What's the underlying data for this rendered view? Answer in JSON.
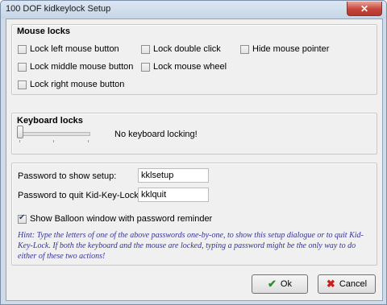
{
  "window": {
    "title": "100 DOF kidkeylock Setup",
    "close_glyph": "✕"
  },
  "mouse_locks": {
    "title": "Mouse locks",
    "options": [
      {
        "label": "Lock left mouse button",
        "checked": false
      },
      {
        "label": "Lock middle mouse button",
        "checked": false
      },
      {
        "label": "Lock right mouse button",
        "checked": false
      },
      {
        "label": "Lock double click",
        "checked": false
      },
      {
        "label": "Lock mouse wheel",
        "checked": false
      },
      {
        "label": "Hide mouse pointer",
        "checked": false
      }
    ]
  },
  "keyboard_locks": {
    "title": "Keyboard locks",
    "slider_value": 0,
    "status": "No keyboard locking!"
  },
  "passwords": {
    "setup_label": "Password to show setup:",
    "setup_value": "kklsetup",
    "quit_label": "Password to quit Kid-Key-Lock:",
    "quit_value": "kklquit",
    "balloon_label": "Show Balloon window with password reminder",
    "balloon_checked": true,
    "hint": "Hint: Type the letters of one of the above passwords one-by-one, to show this setup dialogue or to quit Kid-Key-Lock. If both the keyboard and the mouse are locked, typing a password might be the only way to do either of these two actions!"
  },
  "buttons": {
    "ok": "Ok",
    "cancel": "Cancel",
    "ok_icon": "check-icon",
    "cancel_icon": "x-icon"
  },
  "colors": {
    "hint": "#333399",
    "close": "#c7453a"
  }
}
